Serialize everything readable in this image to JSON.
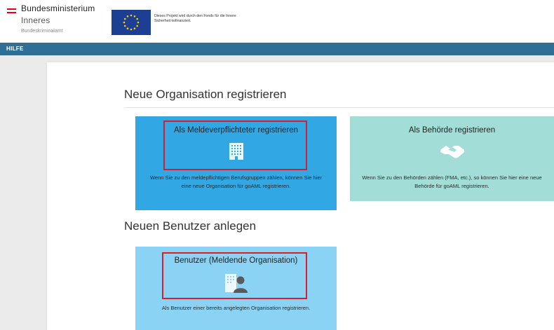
{
  "header": {
    "ministry_line1": "Bundesministerium",
    "ministry_line2": "Inneres",
    "ministry_line3": "Bundeskriminalamt",
    "eu_text": "Dieses Projekt wird durch den Fonds für die Innere Sicherheit kofinanziert."
  },
  "nav": {
    "help": "HILFE"
  },
  "sections": {
    "new_org": "Neue Organisation registrieren",
    "new_user": "Neuen Benutzer anlegen"
  },
  "cards": {
    "reporting_entity": {
      "title": "Als Meldeverpflichteter registrieren",
      "description": "Wenn Sie zu den meldepflichtigen Berufsgruppen zählen, können Sie hier eine neue Organisation für goAML registrieren.",
      "icon": "building-icon",
      "color": "#31a8e4"
    },
    "authority": {
      "title": "Als Behörde registrieren",
      "description": "Wenn Sie zu den Behörden zählen (FMA, etc.), so können Sie hier eine neue Behörde für goAML registrieren.",
      "icon": "handshake-icon",
      "color": "#a3ddd8"
    },
    "user": {
      "title": "Benutzer (Meldende Organisation)",
      "description": "Als Benutzer einer bereits angelegten Organisation registrieren.",
      "icon": "user-building-icon",
      "color": "#8ad3f4"
    }
  },
  "colors": {
    "nav_bar": "#2f6f95",
    "highlight_box": "#d81e2d",
    "austria_red": "#e2001a",
    "eu_blue": "#1c3f94"
  }
}
